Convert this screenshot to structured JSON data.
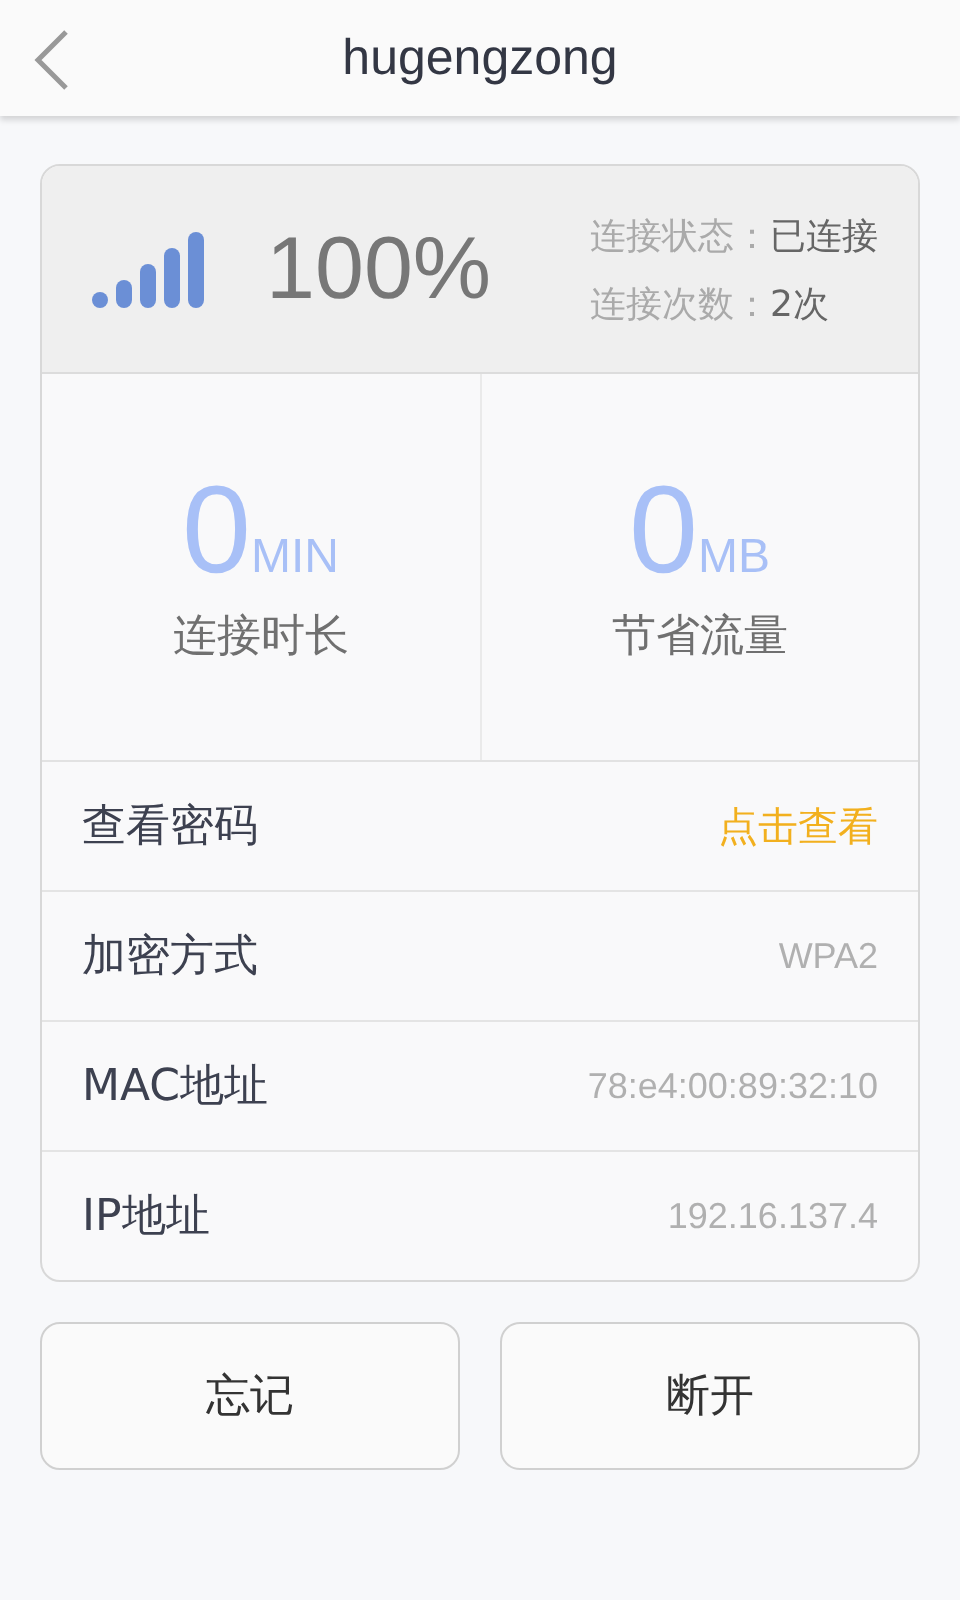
{
  "header": {
    "title": "hugengzong"
  },
  "summary": {
    "percent": "100%",
    "status": [
      {
        "label": "连接状态：",
        "value": "已连接"
      },
      {
        "label": "连接次数：",
        "value": "2次"
      }
    ]
  },
  "stats": [
    {
      "value": "0",
      "unit": "MIN",
      "label": "连接时长"
    },
    {
      "value": "0",
      "unit": "MB",
      "label": "节省流量"
    }
  ],
  "rows": [
    {
      "label": "查看密码",
      "value": "点击查看",
      "kind": "link"
    },
    {
      "label": "加密方式",
      "value": "WPA2",
      "kind": "value"
    },
    {
      "label": "MAC地址",
      "value": "78:e4:00:89:32:10",
      "kind": "value"
    },
    {
      "label": "IP地址",
      "value": "192.16.137.4",
      "kind": "value"
    }
  ],
  "buttons": [
    "忘记",
    "断开"
  ]
}
